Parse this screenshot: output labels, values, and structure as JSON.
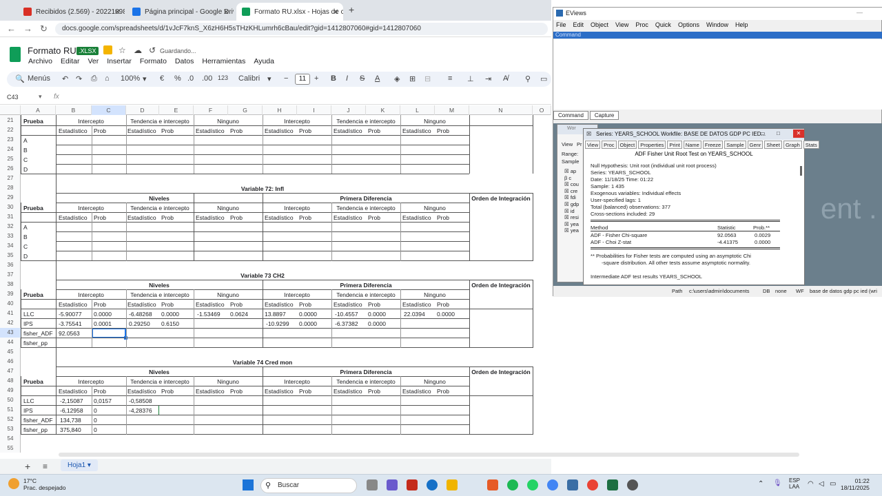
{
  "browser": {
    "tabs": [
      {
        "label": "Recibidos (2.569) - 202210983@",
        "color": "#d93025"
      },
      {
        "label": "Página principal - Google Drive",
        "color": "#1a73e8"
      },
      {
        "label": "Formato RU.xlsx - Hojas de cál",
        "color": "#0f9d58"
      }
    ],
    "url": "docs.google.com/spreadsheets/d/1vJcF7knS_X6zH6H5sTHzKHLumrh6cBau/edit?gid=1412807060#gid=1412807060"
  },
  "sheets": {
    "title": "Formato RU",
    "badge": ".XLSX",
    "status": "Guardando...",
    "menu": [
      "Archivo",
      "Editar",
      "Ver",
      "Insertar",
      "Formato",
      "Datos",
      "Herramientas",
      "Ayuda"
    ],
    "toolbar": {
      "menus": "Menús",
      "zoom": "100%",
      "currency": "€",
      "percent": "%",
      "dec_down": ".0",
      "dec_up": ".00",
      "numformat": "123",
      "font": "Calibri",
      "font_size": "11"
    },
    "namebox": "C43",
    "fx": "fx",
    "columns": [
      "A",
      "B",
      "C",
      "D",
      "E",
      "F",
      "G",
      "H",
      "I",
      "J",
      "K",
      "L",
      "M",
      "N",
      "O"
    ],
    "rows": [
      "21",
      "22",
      "23",
      "24",
      "25",
      "26",
      "27",
      "28",
      "29",
      "30",
      "31",
      "32",
      "33",
      "34",
      "35",
      "36",
      "37",
      "38",
      "39",
      "40",
      "41",
      "42",
      "43",
      "44",
      "45",
      "46",
      "47",
      "48",
      "49",
      "50",
      "51",
      "52",
      "53",
      "54",
      "55"
    ],
    "sheet_tab": "Hoja1",
    "labels": {
      "prueba": "Prueba",
      "intercepto": "Intercepto",
      "tendencia": "Tendencia e intercepto",
      "ninguno": "Ninguno",
      "estadistico": "Estadístico",
      "prob": "Prob",
      "niveles": "Niveles",
      "primera": "Primera Diferencia",
      "orden": "Orden de Integración",
      "var72": "Variable 72: Infl",
      "var73": "Variable 73 CH2",
      "var74": "Variable 74 Cred mon",
      "a": "A",
      "b": "B",
      "c": "C",
      "d": "D",
      "llc": "LLC",
      "ips": "IPS",
      "fadf": "fisher_ADF",
      "fpp": "fisher_pp"
    },
    "v73": {
      "llc": [
        "-5.90077",
        "0.0000",
        "-6.48268",
        "0.0000",
        "-1.53469",
        "0.0624",
        "13.8897",
        "0.0000",
        "-10.4557",
        "0.0000",
        "22.0394",
        "0.0000"
      ],
      "ips": [
        "-3.75541",
        "0.0001",
        "0.29250",
        "0.6150",
        "",
        "",
        "-10.9299",
        "0.0000",
        "-6.37382",
        "0.0000",
        "",
        ""
      ],
      "fadf": "92.0563"
    },
    "v74": {
      "llc": [
        "-2,15087",
        "0,0157",
        "-0,58508"
      ],
      "ips": [
        "-6,12958",
        "0",
        "-4,28376"
      ],
      "fadf": [
        "134,738",
        "0"
      ],
      "fpp": [
        "375,840",
        "0"
      ]
    }
  },
  "eviews": {
    "title": "EViews",
    "menu": [
      "File",
      "Edit",
      "Object",
      "View",
      "Proc",
      "Quick",
      "Options",
      "Window",
      "Help"
    ],
    "command_label": "Command",
    "tabs": [
      "Command",
      "Capture"
    ],
    "status": {
      "path_label": "Path",
      "path": "c:\\users\\admin\\documents",
      "db_label": "DB",
      "db": "none",
      "wf_label": "WF",
      "wf": "base de datos gdp pc ied (wri"
    },
    "watermark": "ent .",
    "workfile": {
      "title": "Wor",
      "items": [
        "ap",
        "c",
        "cou",
        "cre",
        "fdi",
        "gdp",
        "id",
        "resi",
        "yea",
        "yea"
      ],
      "range": "Range:",
      "sample": "Sample",
      "view": "View",
      "pr": "Pr"
    },
    "series": {
      "title": "Series: YEARS_SCHOOL   Workfile: BASE DE DATOS GDP PC IED...",
      "buttons": [
        "View",
        "Proc",
        "Object",
        "Properties",
        "Print",
        "Name",
        "Freeze",
        "Sample",
        "Genr",
        "Sheet",
        "Graph",
        "Stats"
      ],
      "heading": "ADF Fisher Unit Root Test on YEARS_SCHOOL",
      "lines": [
        "Null Hypothesis: Unit root (individual unit root process)",
        "Series:  YEARS_SCHOOL",
        "Date: 11/18/25   Time: 01:22",
        "Sample: 1 435",
        "Exogenous variables: Individual effects",
        "User-specified lags: 1",
        "Total (balanced) observations: 377",
        "Cross-sections included: 29"
      ],
      "table_header": [
        "Method",
        "Statistic",
        "Prob.**"
      ],
      "rows": [
        [
          "ADF - Fisher Chi-square",
          "92.0563",
          "0.0029"
        ],
        [
          "ADF - Choi Z-stat",
          "-4.41375",
          "0.0000"
        ]
      ],
      "note1": "** Probabilities for Fisher tests are computed using an asymptotic Chi",
      "note2": "-square distribution. All other tests assume asymptotic normality.",
      "intermediate": "Intermediate ADF test results YEARS_SCHOOL"
    }
  },
  "taskbar": {
    "weather_temp": "17°C",
    "weather_desc": "Prac. despejado",
    "search": "Buscar",
    "lang1": "ESP",
    "lang2": "LAA",
    "time": "01:22",
    "date": "18/11/2025"
  }
}
